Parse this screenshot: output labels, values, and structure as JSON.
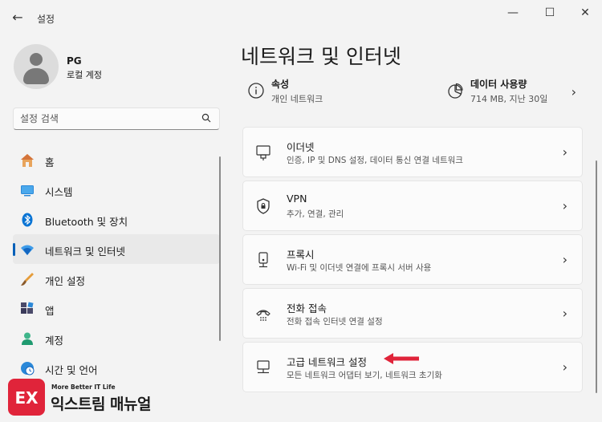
{
  "window": {
    "title": "설정",
    "controls": {
      "minimize": "—",
      "maximize": "☐",
      "close": "✕"
    },
    "back_glyph": "←"
  },
  "profile": {
    "name": "PG",
    "account_type": "로컬 계정"
  },
  "search": {
    "placeholder": "설정 검색"
  },
  "sidebar": {
    "items": [
      {
        "label": "홈",
        "icon": "home-icon"
      },
      {
        "label": "시스템",
        "icon": "system-icon"
      },
      {
        "label": "Bluetooth 및 장치",
        "icon": "bluetooth-icon"
      },
      {
        "label": "네트워크 및 인터넷",
        "icon": "wifi-icon",
        "active": true
      },
      {
        "label": "개인 설정",
        "icon": "brush-icon"
      },
      {
        "label": "앱",
        "icon": "apps-icon"
      },
      {
        "label": "계정",
        "icon": "account-icon"
      },
      {
        "label": "시간 및 언어",
        "icon": "globe-clock-icon"
      }
    ]
  },
  "main": {
    "title": "네트워크 및 인터넷",
    "status": {
      "properties": {
        "title": "속성",
        "subtitle": "개인 네트워크"
      },
      "data_usage": {
        "title": "데이터 사용량",
        "subtitle": "714 MB, 지난 30일"
      }
    },
    "cards": [
      {
        "title": "이더넷",
        "description": "인증, IP 및 DNS 설정, 데이터 통신 연결 네트워크",
        "icon": "ethernet-icon"
      },
      {
        "title": "VPN",
        "description": "추가, 연결, 관리",
        "icon": "vpn-shield-icon"
      },
      {
        "title": "프록시",
        "description": "Wi-Fi 및 이더넷 연결에 프록시 서버 사용",
        "icon": "proxy-icon"
      },
      {
        "title": "전화 접속",
        "description": "전화 접속 인터넷 연결 설정",
        "icon": "dialup-icon"
      },
      {
        "title": "고급 네트워크 설정",
        "description": "모든 네트워크 어댑터 보기, 네트워크 초기화",
        "icon": "advanced-network-icon"
      }
    ],
    "chevron": "›"
  },
  "colors": {
    "accent": "#005fb8",
    "annotation_arrow": "#e0243a",
    "watermark_brand": "#e0243a"
  },
  "watermark": {
    "tagline": "More Better IT Life",
    "name": "익스트림 매뉴얼",
    "logo_text": "EX"
  }
}
